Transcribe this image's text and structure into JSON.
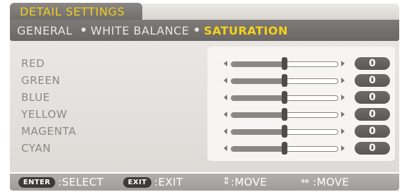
{
  "menu_title": "DETAIL SETTINGS",
  "subnav": {
    "general": "GENERAL",
    "white_balance": "WHITE BALANCE",
    "saturation": "SATURATION"
  },
  "rows": [
    {
      "label": "RED",
      "value": "0",
      "level": 0.5
    },
    {
      "label": "GREEN",
      "value": "0",
      "level": 0.5
    },
    {
      "label": "BLUE",
      "value": "0",
      "level": 0.5
    },
    {
      "label": "YELLOW",
      "value": "0",
      "level": 0.5
    },
    {
      "label": "MAGENTA",
      "value": "0",
      "level": 0.5
    },
    {
      "label": "CYAN",
      "value": "0",
      "level": 0.5
    }
  ],
  "footer": {
    "enter_key": "ENTER",
    "enter_action": ":SELECT",
    "exit_key": "EXIT",
    "exit_action": ":EXIT",
    "updown_icon": "up-down-arrows-icon",
    "updown_action": ":MOVE",
    "leftright_icon": "left-right-arrows-icon",
    "leftright_action": ":MOVE"
  },
  "colors": {
    "title_yellow": "#f2cf1c",
    "selected_yellow": "#f7d21a",
    "label_gray": "#8c8985"
  }
}
